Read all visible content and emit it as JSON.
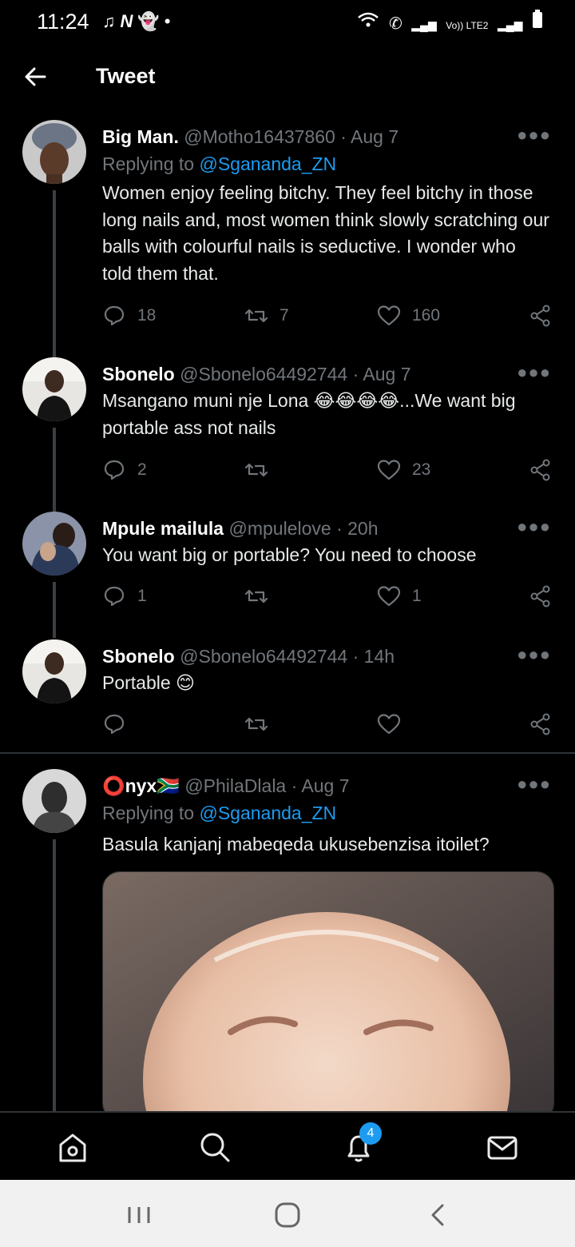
{
  "status_bar": {
    "time": "11:24",
    "left_icons": [
      "music-note-icon",
      "n-icon",
      "snapchat-icon",
      "dot-icon"
    ],
    "right_text": "Vo)) LTE2"
  },
  "header": {
    "title": "Tweet"
  },
  "tweets": [
    {
      "name": "Big Man.",
      "handle": "@Motho16437860",
      "time": "Aug 7",
      "replying_prefix": "Replying to ",
      "replying_to": "@Sgananda_ZN",
      "text": "Women enjoy feeling bitchy. They feel bitchy in those long nails and, most women think slowly scratching our balls with colourful nails is seductive. I wonder who told them that.",
      "replies": "18",
      "retweets": "7",
      "likes": "160"
    },
    {
      "name": "Sbonelo",
      "handle": "@Sbonelo64492744",
      "time": "Aug 7",
      "text": "Msangano muni nje Lona 😂😂😂😂...We want big portable ass not nails",
      "replies": "2",
      "retweets": "",
      "likes": "23"
    },
    {
      "name": "Mpule mailula",
      "handle": "@mpulelove",
      "time": "20h",
      "text": "You want big or portable? You need to choose",
      "replies": "1",
      "retweets": "",
      "likes": "1"
    },
    {
      "name": "Sbonelo",
      "handle": "@Sbonelo64492744",
      "time": "14h",
      "text": "Portable 😊",
      "replies": "",
      "retweets": "",
      "likes": ""
    },
    {
      "name": "⭕nyx🇿🇦",
      "handle": "@PhilaDlala",
      "time": "Aug 7",
      "replying_prefix": "Replying to ",
      "replying_to": "@Sgananda_ZN",
      "text": "Basula kanjanj mabeqeda ukusebenzisa itoilet?"
    }
  ],
  "nav": {
    "notifications_badge": "4"
  },
  "colors": {
    "background": "#000000",
    "accent": "#1d9bf0",
    "muted": "#71767b"
  }
}
